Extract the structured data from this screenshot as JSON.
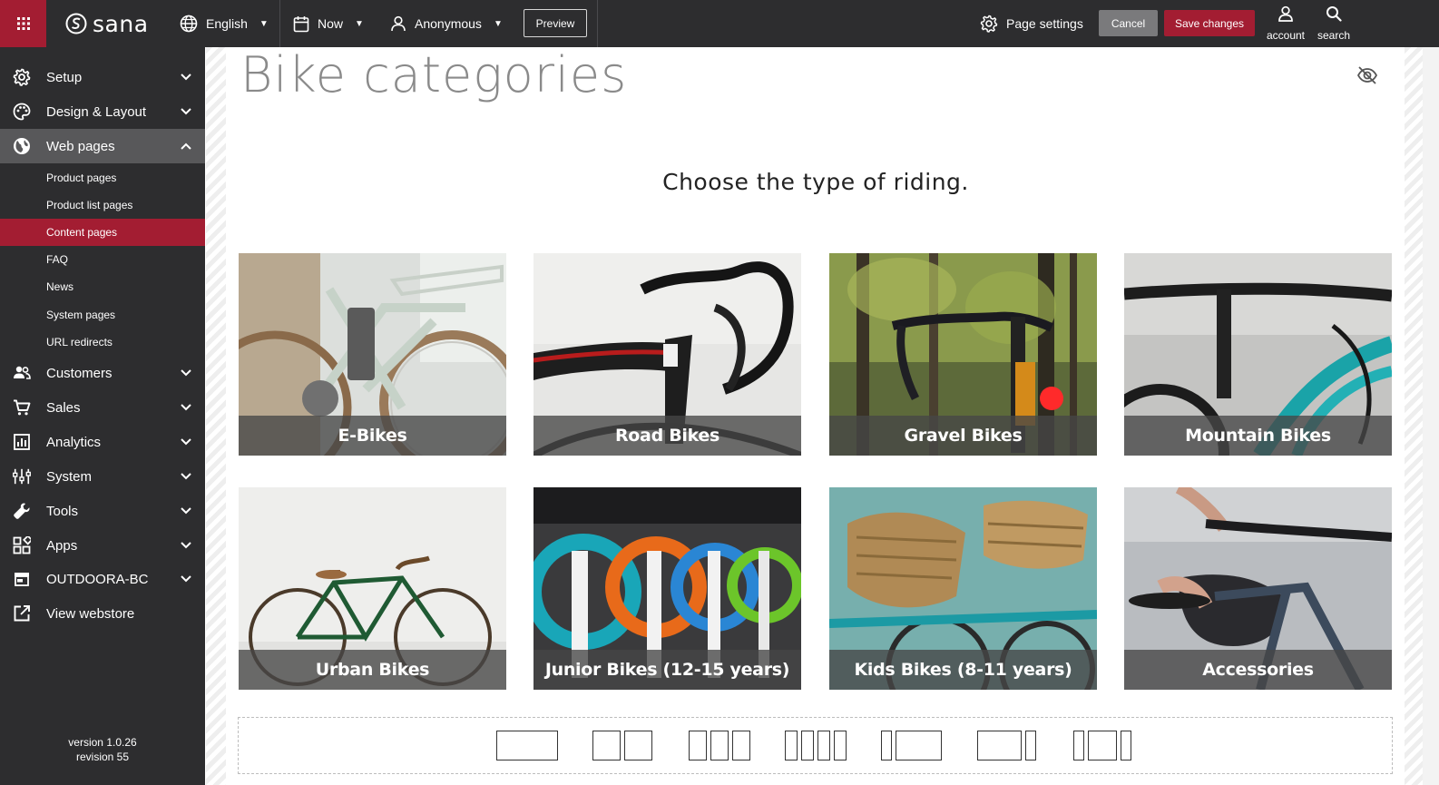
{
  "topbar": {
    "logo_text": "sana",
    "language": "English",
    "date": "Now",
    "user": "Anonymous",
    "preview_label": "Preview",
    "page_settings_label": "Page settings",
    "cancel_label": "Cancel",
    "save_label": "Save changes",
    "account_label": "account",
    "search_label": "search"
  },
  "sidebar": {
    "items": [
      {
        "label": "Setup",
        "icon": "gear-icon"
      },
      {
        "label": "Design & Layout",
        "icon": "palette-icon"
      },
      {
        "label": "Web pages",
        "icon": "globe-icon"
      },
      {
        "label": "Customers",
        "icon": "users-icon"
      },
      {
        "label": "Sales",
        "icon": "cart-icon"
      },
      {
        "label": "Analytics",
        "icon": "chart-icon"
      },
      {
        "label": "System",
        "icon": "sliders-icon"
      },
      {
        "label": "Tools",
        "icon": "wrench-icon"
      },
      {
        "label": "Apps",
        "icon": "apps-icon"
      },
      {
        "label": "OUTDOORA-BC",
        "icon": "store-icon"
      },
      {
        "label": "View webstore",
        "icon": "external-link-icon"
      }
    ],
    "subitems": [
      "Product pages",
      "Product list pages",
      "Content pages",
      "FAQ",
      "News",
      "System pages",
      "URL redirects"
    ],
    "active_subitem": "Content pages",
    "version": "version 1.0.26",
    "revision": "revision 55"
  },
  "content": {
    "title": "Bike categories",
    "subtitle": "Choose the type of riding.",
    "tiles": [
      "E-Bikes",
      "Road Bikes",
      "Gravel Bikes",
      "Mountain Bikes",
      "Urban Bikes",
      "Junior Bikes (12-15 years)",
      "Kids Bikes (8-11 years)",
      "Accessories"
    ]
  },
  "colors": {
    "brand": "#a31d32",
    "dark": "#2d2d2f",
    "cancel": "#7a7a7c"
  }
}
